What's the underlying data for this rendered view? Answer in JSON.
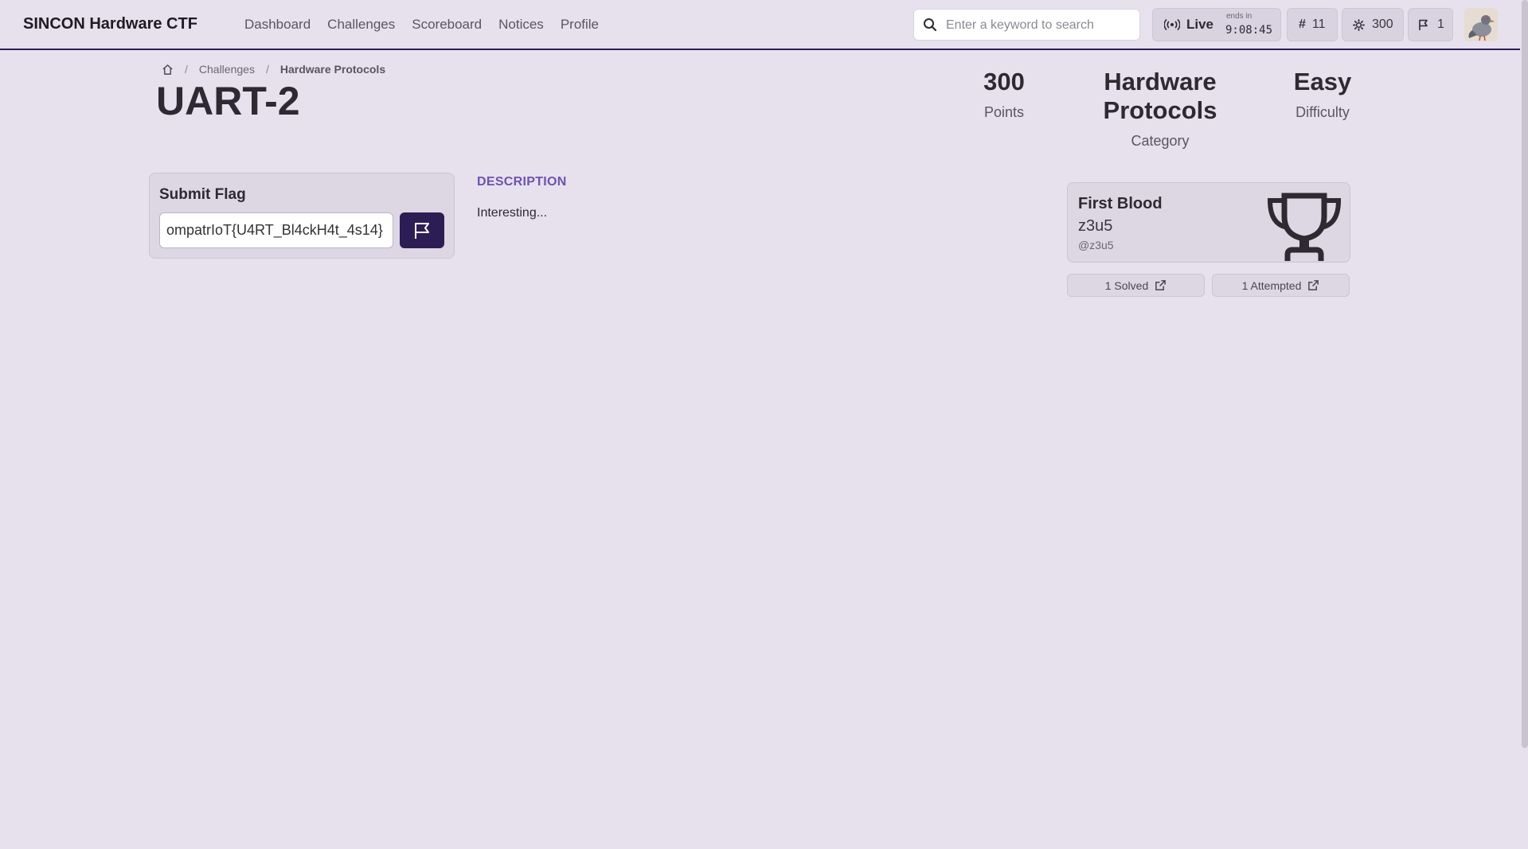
{
  "navbar": {
    "brand": "SINCON Hardware CTF",
    "links": [
      "Dashboard",
      "Challenges",
      "Scoreboard",
      "Notices",
      "Profile"
    ],
    "search_placeholder": "Enter a keyword to search",
    "live_label": "Live",
    "ends_in_label": "ends in",
    "timer": "9:08:45",
    "rank_icon": "#",
    "rank": "11",
    "points": "300",
    "flags": "1"
  },
  "breadcrumb": {
    "items": [
      "Challenges",
      "Hardware Protocols"
    ]
  },
  "challenge": {
    "title": "UART-2",
    "points_value": "300",
    "points_label": "Points",
    "category_value": "Hardware Protocols",
    "category_label": "Category",
    "difficulty_value": "Easy",
    "difficulty_label": "Difficulty"
  },
  "submit": {
    "title": "Submit Flag",
    "flag_value": "ompatrIoT{U4RT_Bl4ckH4t_4s14}"
  },
  "description": {
    "heading": "DESCRIPTION",
    "body": "Interesting..."
  },
  "first_blood": {
    "title": "First Blood",
    "name": "z3u5",
    "handle": "@z3u5",
    "solved_label": "1 Solved",
    "attempted_label": "1 Attempted"
  },
  "colors": {
    "background": "#e7e1ee",
    "primary": "#2c1e55",
    "accent": "#6c53b0"
  }
}
